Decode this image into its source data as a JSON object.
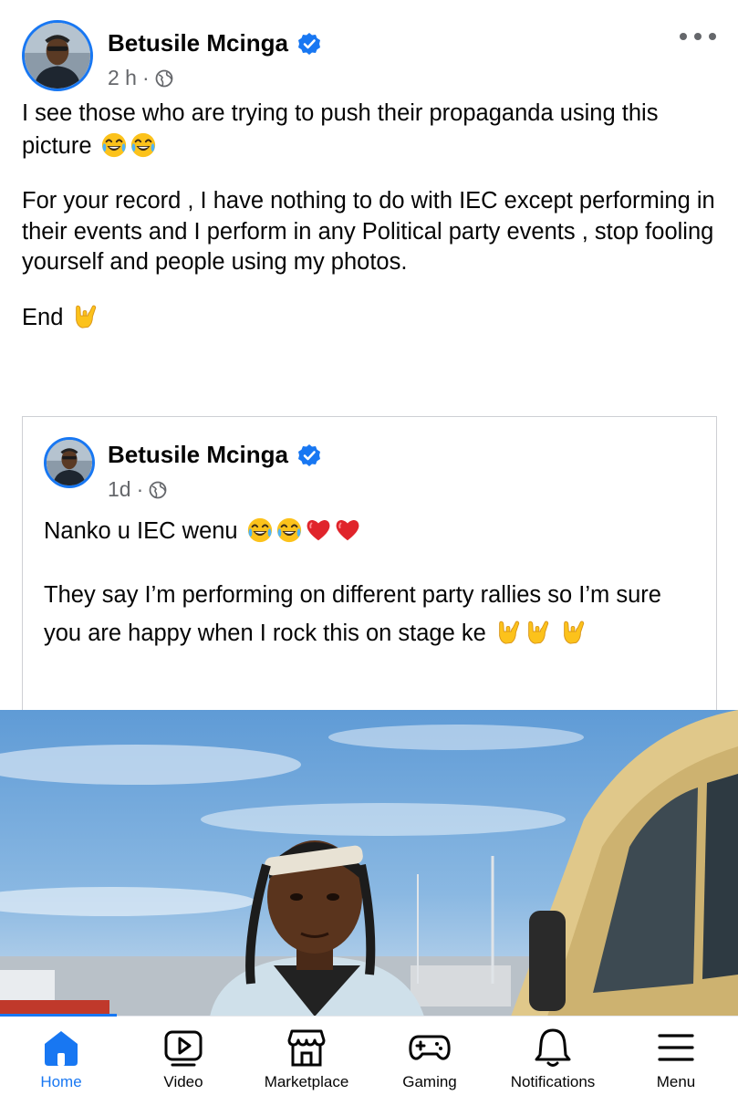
{
  "post": {
    "author": "Betusile Mcinga",
    "time": "2 h",
    "dot": "·",
    "text_p1": "I see those who are trying to push their propaganda using this picture",
    "text_p2": "For your record , I have nothing to do with IEC except performing in their events and I perform in any Political party events , stop fooling yourself and people using my photos.",
    "text_p3": "End",
    "p1_emojis": [
      "laughing-emoji",
      "laughing-emoji"
    ],
    "p3_emojis": [
      "love-you-gesture-emoji"
    ]
  },
  "shared": {
    "author": "Betusile Mcinga",
    "time": "1d",
    "dot": "·",
    "text_p1": "Nanko u IEC wenu",
    "text_p2": "They say I’m performing on different party rallies so I’m sure you are happy when I rock this on stage ke",
    "p1_emojis": [
      "laughing-emoji",
      "laughing-emoji",
      "red-heart-emoji",
      "red-heart-emoji"
    ],
    "p2_emojis": [
      "love-you-gesture-emoji",
      "love-you-gesture-emoji",
      "love-you-gesture-emoji"
    ]
  },
  "tabs": [
    {
      "label": "Home",
      "icon": "home-icon",
      "active": true
    },
    {
      "label": "Video",
      "icon": "video-icon",
      "active": false
    },
    {
      "label": "Marketplace",
      "icon": "marketplace-icon",
      "active": false
    },
    {
      "label": "Gaming",
      "icon": "gaming-icon",
      "active": false
    },
    {
      "label": "Notifications",
      "icon": "bell-icon",
      "active": false
    },
    {
      "label": "Menu",
      "icon": "menu-icon",
      "active": false
    }
  ],
  "colors": {
    "accent": "#1877f2",
    "secondary_text": "#65676b",
    "text": "#050505",
    "border": "#ced0d4"
  }
}
